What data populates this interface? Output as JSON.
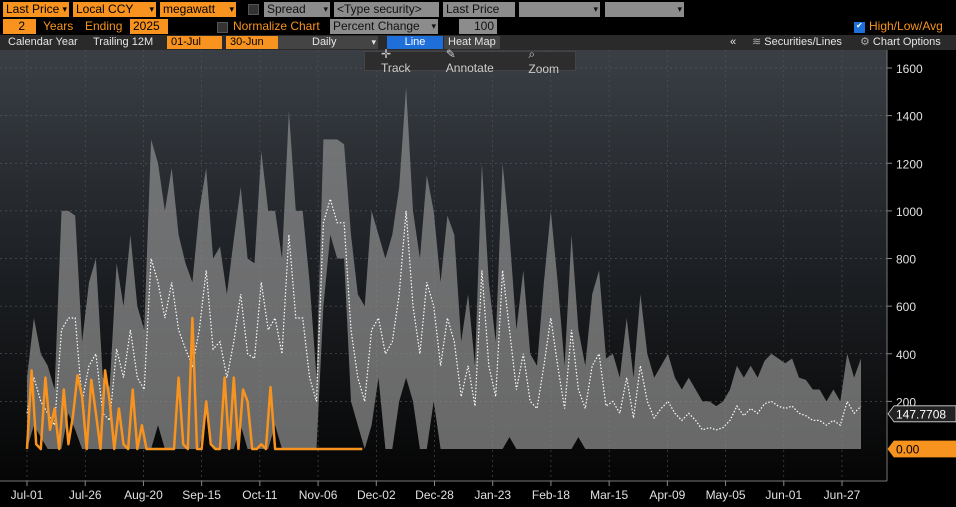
{
  "toolbar1": {
    "price_field": "Last Price",
    "currency": "Local CCY",
    "units": "megawatt",
    "spread_label": "Spread",
    "type_security": "<Type security>",
    "price_field2": "Last Price"
  },
  "toolbar2": {
    "years_value": "2",
    "years_label": "Years",
    "ending_label": "Ending",
    "ending_year": "2025",
    "normalize_label": "Normalize Chart",
    "normalize_mode": "Percent Change",
    "normalize_value": "100",
    "hla_label": "High/Low/Avg"
  },
  "toolbar3": {
    "calendar_year": "Calendar Year",
    "trailing": "Trailing 12M",
    "start": "01-Jul",
    "end": "30-Jun",
    "frequency": "Daily",
    "line_tab": "Line",
    "heatmap_tab": "Heat Map",
    "collapse": "«",
    "securities": "Securities/Lines",
    "chart_options": "Chart Options"
  },
  "tools": {
    "track": "Track",
    "annotate": "Annotate",
    "zoom": "Zoom"
  },
  "colors": {
    "orange": "#f7931e",
    "band": "#8a8a8a",
    "avg": "#ffffff",
    "background": "#000000"
  },
  "chart_data": {
    "type": "line",
    "x_tick_labels": [
      "Jul-01",
      "Jul-26",
      "Aug-20",
      "Sep-15",
      "Oct-11",
      "Nov-06",
      "Dec-02",
      "Dec-28",
      "Jan-23",
      "Feb-18",
      "Mar-15",
      "Apr-09",
      "May-05",
      "Jun-01",
      "Jun-27"
    ],
    "y_ticks": [
      200,
      400,
      600,
      800,
      1000,
      1200,
      1400,
      1600
    ],
    "ylim": [
      -150,
      1700
    ],
    "last_value_labels": [
      "147.7708",
      "0.00"
    ],
    "x": [
      0,
      3,
      6,
      9,
      12,
      15,
      18,
      21,
      24,
      27,
      30,
      33,
      36,
      39,
      42,
      45,
      48,
      51,
      54,
      57,
      60,
      63,
      66,
      69,
      72,
      75,
      78,
      81,
      84,
      87,
      90,
      93,
      96,
      99,
      102,
      105,
      108,
      111,
      114,
      117,
      120,
      123,
      126,
      129,
      132,
      135,
      138,
      141,
      144,
      147,
      150,
      153,
      156,
      159,
      162,
      165,
      168,
      171,
      174,
      177,
      180,
      183,
      186,
      189,
      192,
      195,
      198,
      201,
      204,
      207,
      210,
      213,
      216,
      219,
      222,
      225,
      228,
      231,
      234,
      237,
      240,
      243,
      246,
      249,
      252,
      255,
      258,
      261,
      264,
      267,
      270,
      273,
      276,
      279,
      282,
      285,
      288,
      291,
      294,
      297,
      300,
      303,
      306,
      309,
      312,
      315,
      318,
      321,
      324,
      327,
      330,
      333,
      336,
      339,
      342,
      345,
      348,
      351,
      354,
      357,
      360,
      363
    ],
    "series": [
      {
        "role": "band",
        "high": [
          300,
          550,
          400,
          350,
          250,
          1000,
          1000,
          980,
          450,
          700,
          800,
          300,
          260,
          780,
          600,
          900,
          600,
          500,
          1300,
          1200,
          1000,
          1180,
          900,
          780,
          700,
          1000,
          1180,
          800,
          850,
          650,
          880,
          1100,
          800,
          780,
          1250,
          1000,
          1000,
          800,
          1420,
          1000,
          1000,
          700,
          300,
          1300,
          1300,
          1300,
          1280,
          900,
          650,
          600,
          1000,
          900,
          800,
          900,
          1100,
          1520,
          1000,
          800,
          1150,
          1000,
          700,
          980,
          900,
          450,
          650,
          350,
          1200,
          700,
          450,
          1200,
          900,
          500,
          750,
          400,
          350,
          700,
          1000,
          700,
          350,
          900,
          500,
          350,
          650,
          750,
          380,
          400,
          300,
          550,
          300,
          650,
          400,
          300,
          350,
          400,
          300,
          250,
          300,
          250,
          200,
          200,
          180,
          200,
          250,
          350,
          300,
          350,
          300,
          370,
          400,
          380,
          360,
          380,
          300,
          290,
          250,
          250,
          200,
          250,
          200,
          400,
          300,
          380
        ],
        "low": [
          0,
          100,
          50,
          0,
          0,
          0,
          150,
          80,
          0,
          0,
          0,
          0,
          0,
          0,
          0,
          0,
          0,
          0,
          0,
          100,
          0,
          0,
          0,
          0,
          0,
          0,
          150,
          0,
          0,
          0,
          0,
          100,
          0,
          0,
          0,
          0,
          100,
          0,
          0,
          0,
          0,
          0,
          0,
          600,
          900,
          800,
          800,
          200,
          100,
          0,
          100,
          300,
          0,
          0,
          200,
          300,
          200,
          0,
          0,
          200,
          0,
          0,
          0,
          0,
          0,
          0,
          0,
          0,
          0,
          0,
          50,
          0,
          0,
          0,
          0,
          0,
          0,
          0,
          0,
          0,
          50,
          0,
          0,
          0,
          0,
          0,
          0,
          0,
          0,
          0,
          0,
          0,
          0,
          0,
          0,
          0,
          0,
          0,
          0,
          0,
          0,
          0,
          0,
          0,
          0,
          0,
          0,
          0,
          0,
          0,
          0,
          0,
          0,
          0,
          0,
          0,
          0,
          0,
          0,
          0,
          0,
          0
        ],
        "avg": [
          150,
          300,
          200,
          150,
          100,
          500,
          550,
          550,
          200,
          350,
          400,
          150,
          120,
          420,
          300,
          500,
          300,
          250,
          800,
          700,
          550,
          700,
          500,
          420,
          350,
          500,
          750,
          420,
          450,
          300,
          450,
          650,
          400,
          380,
          700,
          500,
          550,
          400,
          900,
          550,
          550,
          300,
          200,
          950,
          1050,
          950,
          950,
          500,
          300,
          200,
          500,
          550,
          400,
          450,
          650,
          1000,
          600,
          400,
          700,
          600,
          350,
          550,
          450,
          220,
          350,
          180,
          750,
          350,
          220,
          750,
          500,
          250,
          400,
          200,
          170,
          350,
          550,
          350,
          170,
          500,
          250,
          170,
          350,
          400,
          180,
          200,
          150,
          300,
          130,
          350,
          200,
          130,
          170,
          200,
          150,
          120,
          150,
          120,
          80,
          90,
          80,
          90,
          120,
          180,
          140,
          170,
          150,
          190,
          200,
          180,
          170,
          180,
          150,
          140,
          120,
          120,
          100,
          120,
          100,
          200,
          150,
          180
        ]
      },
      {
        "role": "current",
        "color": "#f7931e",
        "x": [
          0,
          2,
          4,
          6,
          8,
          10,
          12,
          14,
          16,
          18,
          20,
          22,
          24,
          26,
          28,
          30,
          32,
          34,
          36,
          38,
          40,
          42,
          44,
          46,
          48,
          50,
          52,
          54,
          56,
          58,
          60,
          62,
          64,
          66,
          68,
          70,
          72,
          74,
          76,
          78,
          80,
          82,
          84,
          86,
          88,
          90,
          92,
          94,
          96,
          98,
          100,
          102,
          104,
          106,
          108,
          110,
          112,
          114,
          116,
          118,
          120,
          122,
          124,
          126,
          128,
          130,
          132,
          134,
          136,
          138,
          140,
          142,
          144,
          146
        ],
        "values": [
          0,
          330,
          20,
          0,
          300,
          80,
          170,
          0,
          250,
          20,
          140,
          310,
          220,
          0,
          290,
          150,
          0,
          330,
          200,
          0,
          170,
          20,
          0,
          250,
          0,
          100,
          0,
          0,
          0,
          0,
          0,
          0,
          0,
          300,
          20,
          0,
          550,
          0,
          0,
          200,
          20,
          0,
          0,
          300,
          0,
          300,
          0,
          250,
          200,
          0,
          0,
          20,
          0,
          260,
          0,
          0,
          0,
          0,
          0,
          0,
          0,
          0,
          0,
          0,
          0,
          0,
          0,
          0,
          0,
          0,
          0,
          0,
          0,
          0
        ]
      }
    ]
  }
}
